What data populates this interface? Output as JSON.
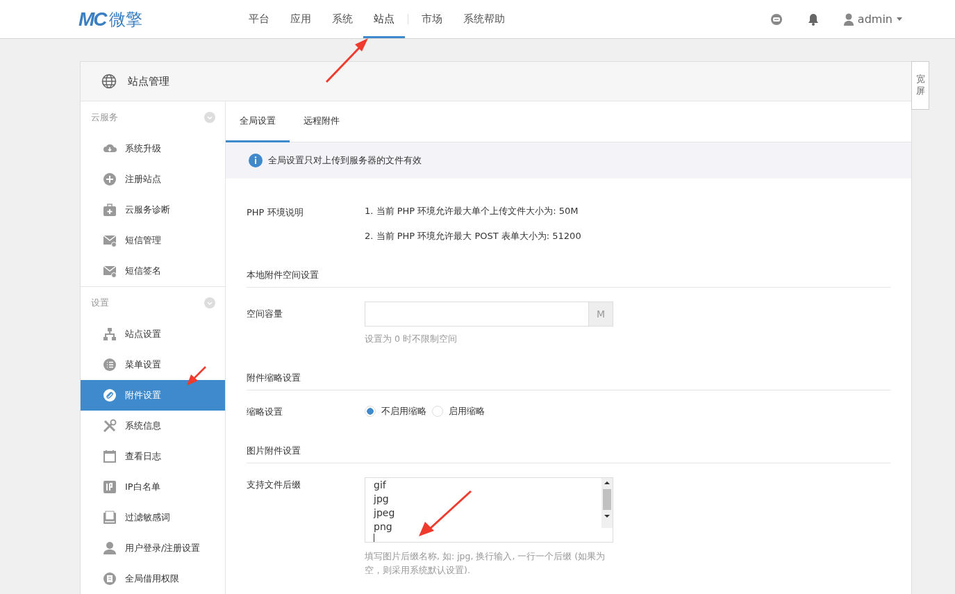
{
  "brand": {
    "mark": "MC",
    "name": "微擎"
  },
  "nav": [
    {
      "label": "平台",
      "selected": false
    },
    {
      "label": "应用",
      "selected": false
    },
    {
      "label": "系统",
      "selected": false
    },
    {
      "label": "站点",
      "selected": true
    },
    {
      "label": "市场",
      "selected": false
    },
    {
      "label": "系统帮助",
      "selected": false
    }
  ],
  "user": {
    "name": "admin"
  },
  "panel": {
    "title": "站点管理",
    "wide_button": "宽屏"
  },
  "sidebar": [
    {
      "title": "云服务",
      "items": [
        {
          "label": "系统升级",
          "selected": false
        },
        {
          "label": "注册站点",
          "selected": false
        },
        {
          "label": "云服务诊断",
          "selected": false
        },
        {
          "label": "短信管理",
          "selected": false
        },
        {
          "label": "短信签名",
          "selected": false
        }
      ]
    },
    {
      "title": "设置",
      "items": [
        {
          "label": "站点设置",
          "selected": false
        },
        {
          "label": "菜单设置",
          "selected": false
        },
        {
          "label": "附件设置",
          "selected": true
        },
        {
          "label": "系统信息",
          "selected": false
        },
        {
          "label": "查看日志",
          "selected": false
        },
        {
          "label": "IP白名单",
          "selected": false
        },
        {
          "label": "过滤敏感词",
          "selected": false
        },
        {
          "label": "用户登录/注册设置",
          "selected": false
        },
        {
          "label": "全局借用权限",
          "selected": false
        }
      ]
    }
  ],
  "tabs": [
    {
      "label": "全局设置",
      "selected": true
    },
    {
      "label": "远程附件",
      "selected": false
    }
  ],
  "notice": "全局设置只对上传到服务器的文件有效",
  "php_env": {
    "label": "PHP 环境说明",
    "lines": [
      "1. 当前 PHP 环境允许最大单个上传文件大小为: 50M",
      "2. 当前 PHP 环境允许最大 POST 表单大小为: 51200"
    ]
  },
  "local_storage": {
    "heading": "本地附件空间设置",
    "label": "空间容量",
    "unit": "M",
    "help": "设置为 0 时不限制空间"
  },
  "thumbnail": {
    "heading": "附件缩略设置",
    "label": "缩略设置",
    "options": [
      {
        "label": "不启用缩略",
        "selected": true
      },
      {
        "label": "启用缩略",
        "selected": false
      }
    ]
  },
  "image": {
    "heading": "图片附件设置",
    "label": "支持文件后缀",
    "lines": [
      "gif",
      "jpg",
      "jpeg",
      "png"
    ],
    "help": "填写图片后缀名称, 如: jpg, 换行输入, 一行一个后缀 (如果为空，则采用系统默认设置)."
  }
}
